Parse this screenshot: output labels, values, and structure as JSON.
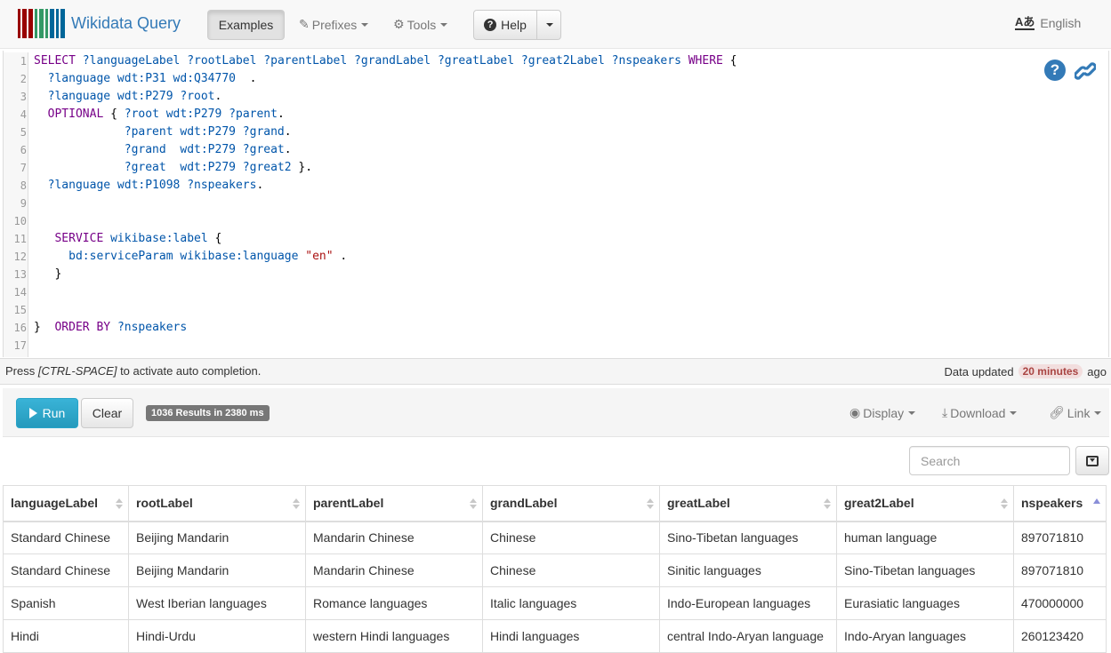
{
  "nav": {
    "brand": "Wikidata Query",
    "examples": "Examples",
    "prefixes": "Prefixes",
    "tools": "Tools",
    "help": "Help",
    "language": "English",
    "language_icon": "Aあ"
  },
  "editor": {
    "lines": [
      {
        "n": "1",
        "code": [
          [
            "kw",
            "SELECT "
          ],
          [
            "var",
            "?languageLabel ?rootLabel ?parentLabel ?grandLabel ?greatLabel ?great2Label ?nspeakers "
          ],
          [
            "kw",
            "WHERE"
          ],
          [
            "plain",
            " {"
          ]
        ]
      },
      {
        "n": "2",
        "code": [
          [
            "plain",
            "  "
          ],
          [
            "var",
            "?language wdt:P31 wd:Q34770"
          ],
          [
            "plain",
            "  ."
          ]
        ]
      },
      {
        "n": "3",
        "code": [
          [
            "plain",
            "  "
          ],
          [
            "var",
            "?language wdt:P279 ?root"
          ],
          [
            "plain",
            "."
          ]
        ]
      },
      {
        "n": "4",
        "code": [
          [
            "plain",
            "  "
          ],
          [
            "kw",
            "OPTIONAL"
          ],
          [
            "plain",
            " { "
          ],
          [
            "var",
            "?root wdt:P279 ?parent"
          ],
          [
            "plain",
            "."
          ]
        ]
      },
      {
        "n": "5",
        "code": [
          [
            "plain",
            "             "
          ],
          [
            "var",
            "?parent wdt:P279 ?grand"
          ],
          [
            "plain",
            "."
          ]
        ]
      },
      {
        "n": "6",
        "code": [
          [
            "plain",
            "             "
          ],
          [
            "var",
            "?grand  wdt:P279 ?great"
          ],
          [
            "plain",
            "."
          ]
        ]
      },
      {
        "n": "7",
        "code": [
          [
            "plain",
            "             "
          ],
          [
            "var",
            "?great  wdt:P279 ?great2"
          ],
          [
            "plain",
            " }."
          ]
        ]
      },
      {
        "n": "8",
        "code": [
          [
            "plain",
            "  "
          ],
          [
            "var",
            "?language wdt:P1098 ?nspeakers"
          ],
          [
            "plain",
            "."
          ]
        ]
      },
      {
        "n": "9",
        "code": []
      },
      {
        "n": "10",
        "code": []
      },
      {
        "n": "11",
        "code": [
          [
            "plain",
            "   "
          ],
          [
            "kw",
            "SERVICE"
          ],
          [
            "plain",
            " "
          ],
          [
            "var",
            "wikibase:label"
          ],
          [
            "plain",
            " {"
          ]
        ]
      },
      {
        "n": "12",
        "code": [
          [
            "plain",
            "     "
          ],
          [
            "var",
            "bd:serviceParam wikibase:language"
          ],
          [
            "plain",
            " "
          ],
          [
            "str",
            "\"en\""
          ],
          [
            "plain",
            " ."
          ]
        ]
      },
      {
        "n": "13",
        "code": [
          [
            "plain",
            "   }"
          ]
        ]
      },
      {
        "n": "14",
        "code": []
      },
      {
        "n": "15",
        "code": []
      },
      {
        "n": "16",
        "code": [
          [
            "plain",
            "}  "
          ],
          [
            "kw",
            "ORDER BY"
          ],
          [
            "plain",
            " "
          ],
          [
            "var",
            "?nspeakers"
          ]
        ]
      },
      {
        "n": "17",
        "code": []
      }
    ]
  },
  "status": {
    "hint_prefix": "Press ",
    "hint_key": "[CTRL-SPACE]",
    "hint_suffix": " to activate auto completion.",
    "updated_prefix": "Data updated",
    "updated_badge": "20 minutes",
    "updated_suffix": "ago"
  },
  "actions": {
    "run": "Run",
    "clear": "Clear",
    "results_badge": "1036 Results in 2380 ms",
    "display": "Display",
    "download": "Download",
    "link": "Link"
  },
  "results": {
    "search_placeholder": "Search",
    "columns": [
      "languageLabel",
      "rootLabel",
      "parentLabel",
      "grandLabel",
      "greatLabel",
      "great2Label",
      "nspeakers"
    ],
    "rows": [
      [
        "Standard Chinese",
        "Beijing Mandarin",
        "Mandarin Chinese",
        "Chinese",
        "Sino-Tibetan languages",
        "human language",
        "897071810"
      ],
      [
        "Standard Chinese",
        "Beijing Mandarin",
        "Mandarin Chinese",
        "Chinese",
        "Sinitic languages",
        "Sino-Tibetan languages",
        "897071810"
      ],
      [
        "Spanish",
        "West Iberian languages",
        "Romance languages",
        "Italic languages",
        "Indo-European languages",
        "Eurasiatic languages",
        "470000000"
      ],
      [
        "Hindi",
        "Hindi-Urdu",
        "western Hindi languages",
        "Hindi languages",
        "central Indo-Aryan language",
        "Indo-Aryan languages",
        "260123420"
      ]
    ]
  },
  "colors": {
    "brand": "#337ab7",
    "run_button": "#31b0d5",
    "keyword": "#770088",
    "variable": "#0055aa",
    "string": "#aa1111"
  },
  "icons": [
    "wikidata-barcode-logo",
    "pin-icon",
    "gear-icon",
    "question-circle-icon",
    "link-icon",
    "eye-icon",
    "download-icon",
    "play-icon",
    "column-toggle-icon",
    "sort-icon"
  ]
}
